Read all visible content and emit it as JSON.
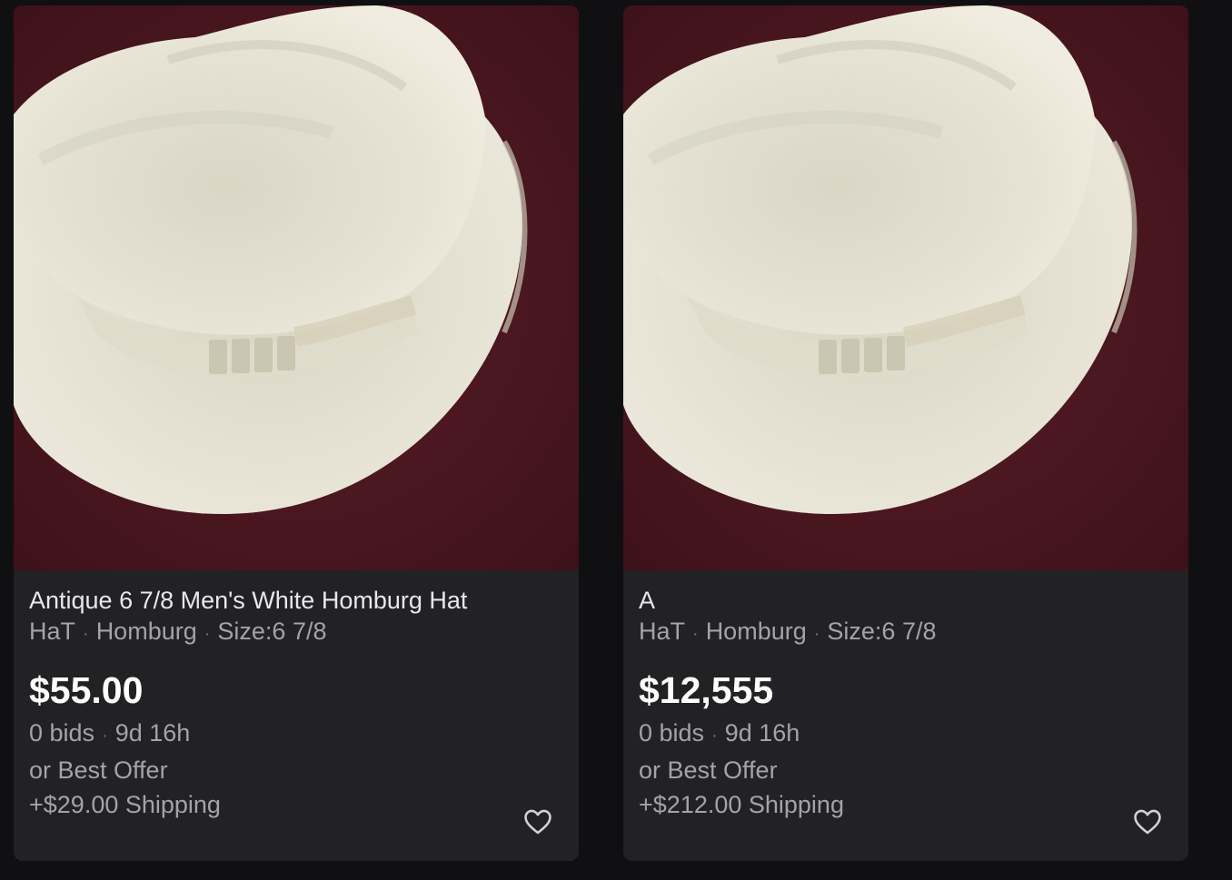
{
  "listings": [
    {
      "image_icon": "hat-photo",
      "title": "Antique 6 7/8 Men's White Homburg Hat",
      "specs": [
        "HaT",
        "Homburg",
        "Size:6 7/8"
      ],
      "price": "$55.00",
      "bids_time": [
        "0 bids",
        "9d 16h"
      ],
      "offer": "or Best Offer",
      "shipping": "+$29.00 Shipping",
      "watch_icon": "heart-icon"
    },
    {
      "image_icon": "hat-photo",
      "title": "A",
      "specs": [
        "HaT",
        "Homburg",
        "Size:6 7/8"
      ],
      "price": "$12,555",
      "bids_time": [
        "0 bids",
        "9d 16h"
      ],
      "offer": "or Best Offer",
      "shipping": "+$212.00 Shipping",
      "watch_icon": "heart-icon"
    }
  ],
  "colors": {
    "background": "#101012",
    "card": "#222225",
    "photo_backdrop": "#4a1720",
    "hat": "#ebe7d8",
    "text_primary": "#e8e8ea",
    "text_secondary": "#a3a3a8",
    "price": "#ffffff"
  }
}
